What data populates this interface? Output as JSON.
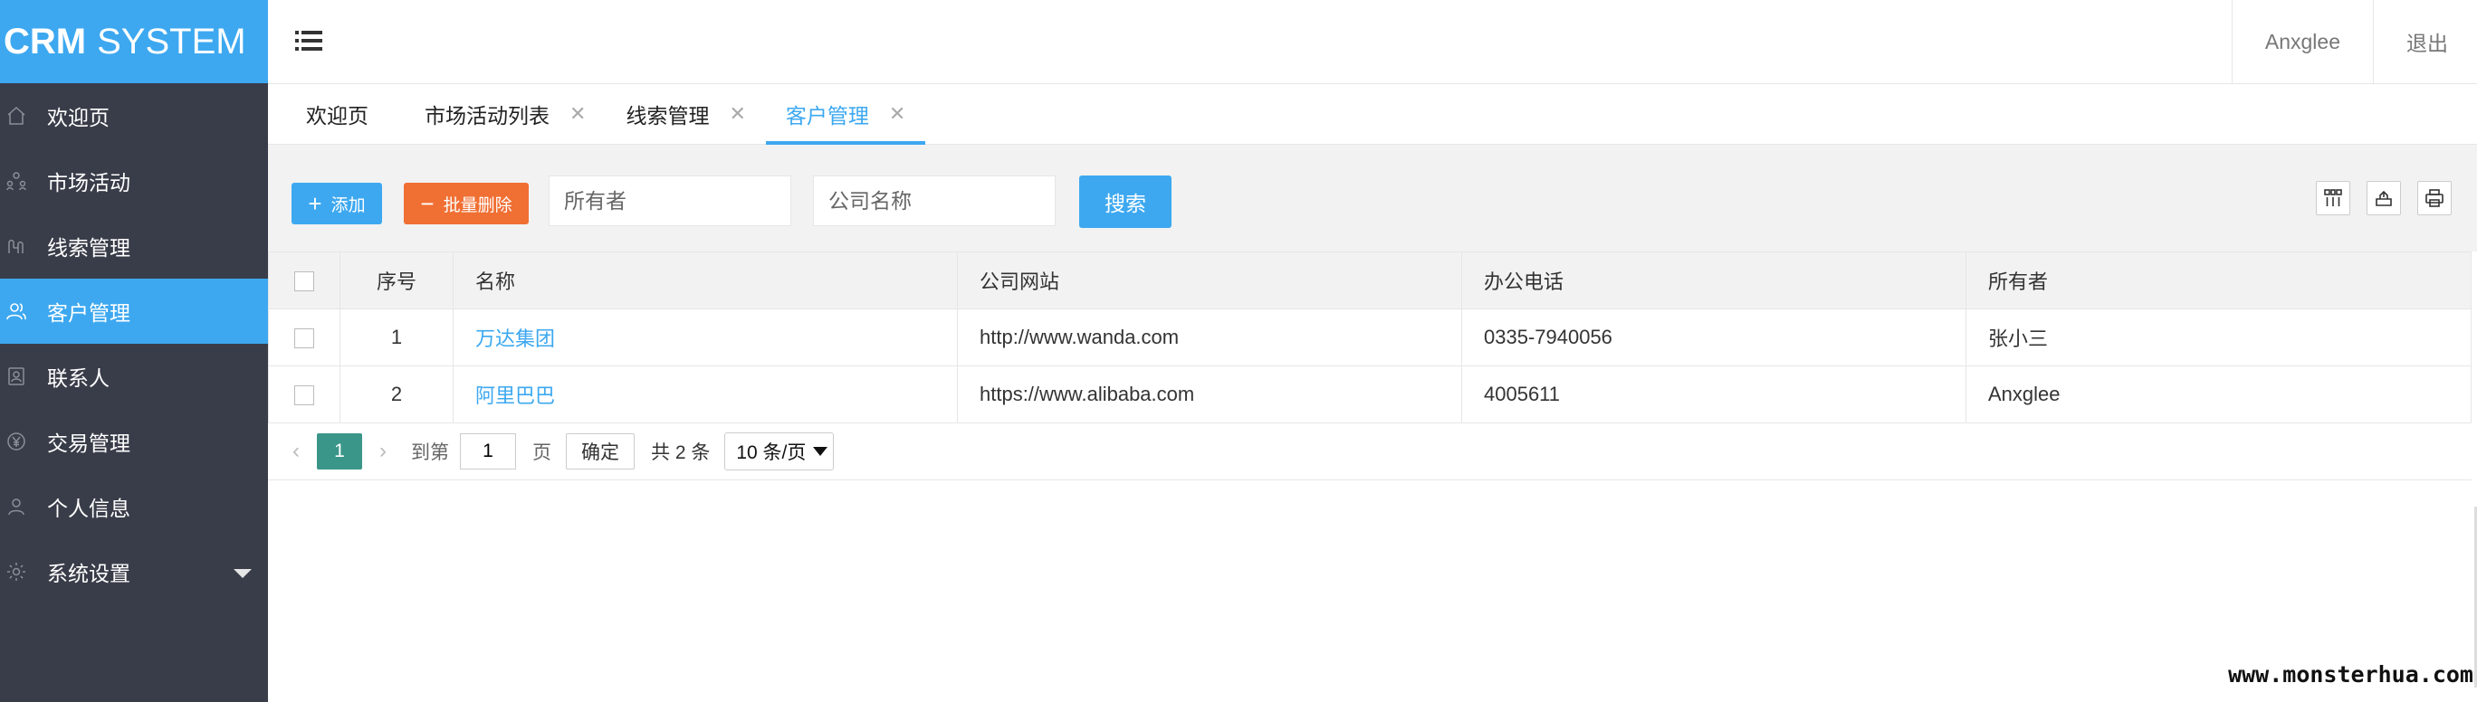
{
  "app": {
    "logo_bold": "CRM",
    "logo_rest": "SYSTEM"
  },
  "sidebar": {
    "items": [
      {
        "label": "欢迎页",
        "icon": "home-icon"
      },
      {
        "label": "市场活动",
        "icon": "users-group-icon"
      },
      {
        "label": "线索管理",
        "icon": "clue-icon"
      },
      {
        "label": "客户管理",
        "icon": "user-icon",
        "active": true
      },
      {
        "label": "联系人",
        "icon": "contact-card-icon"
      },
      {
        "label": "交易管理",
        "icon": "currency-icon"
      },
      {
        "label": "个人信息",
        "icon": "person-icon"
      },
      {
        "label": "系统设置",
        "icon": "gear-icon"
      }
    ]
  },
  "header": {
    "user": "Anxglee",
    "logout": "退出"
  },
  "tabs": [
    {
      "label": "欢迎页"
    },
    {
      "label": "市场活动列表"
    },
    {
      "label": "线索管理"
    },
    {
      "label": "客户管理",
      "active": true
    }
  ],
  "toolbar": {
    "add_label": "添加",
    "batch_delete_label": "批量删除",
    "owner_placeholder": "所有者",
    "company_placeholder": "公司名称",
    "search_label": "搜索"
  },
  "table": {
    "headers": {
      "no": "序号",
      "name": "名称",
      "website": "公司网站",
      "phone": "办公电话",
      "owner": "所有者"
    },
    "rows": [
      {
        "no": "1",
        "name": "万达集团",
        "website": "http://www.wanda.com",
        "phone": "0335-7940056",
        "owner": "张小三"
      },
      {
        "no": "2",
        "name": "阿里巴巴",
        "website": "https://www.alibaba.com",
        "phone": "4005611",
        "owner": "Anxglee"
      }
    ]
  },
  "pager": {
    "current": "1",
    "goto_label": "到第",
    "page_value": "1",
    "page_unit": "页",
    "confirm": "确定",
    "total": "共 2 条",
    "per_page": "10 条/页"
  },
  "watermark": "www.monsterhua.com",
  "colors": {
    "accent": "#3da8f0",
    "danger": "#f06f33",
    "sidebar": "#393d49",
    "pager_active": "#3a9688"
  }
}
